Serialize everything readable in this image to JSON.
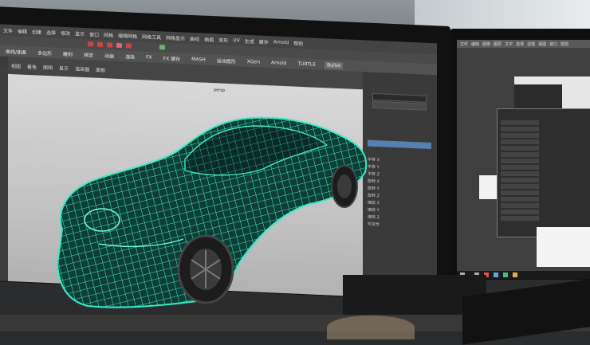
{
  "left_screen": {
    "menu_items": [
      "文件",
      "编辑",
      "创建",
      "选择",
      "修改",
      "显示",
      "窗口",
      "网格",
      "编辑网格",
      "网格工具",
      "网格显示",
      "曲线",
      "曲面",
      "变形",
      "UV",
      "生成",
      "缓存",
      "Arnold",
      "帮助"
    ],
    "shelf_tabs": [
      "曲线/曲面",
      "多边形",
      "雕刻",
      "绑定",
      "动画",
      "渲染",
      "FX",
      "FX 缓存",
      "MASH",
      "运动图形",
      "XGen",
      "Arnold",
      "TURTLE",
      "Bullet"
    ],
    "shelf_active_tab": "Bullet",
    "viewport_menu": [
      "视图",
      "着色",
      "照明",
      "显示",
      "渲染器",
      "面板"
    ],
    "camera_label": "persp",
    "channel_box_rows": [
      "平移 X",
      "平移 Y",
      "平移 Z",
      "旋转 X",
      "旋转 Y",
      "旋转 Z",
      "缩放 X",
      "缩放 Y",
      "缩放 Z",
      "可见性"
    ]
  },
  "right_screen": {
    "menu_items": [
      "文件",
      "编辑",
      "图像",
      "图层",
      "文字",
      "选择",
      "滤镜",
      "视图",
      "窗口",
      "帮助"
    ]
  },
  "colors": {
    "wireframe": "#3ce8c4",
    "wire_glow": "#22ffd0",
    "viewport_bg": "#cfcfcf",
    "ui_dark": "#3b3b3b"
  },
  "icons": {
    "wireframe_model": "car-wireframe"
  }
}
